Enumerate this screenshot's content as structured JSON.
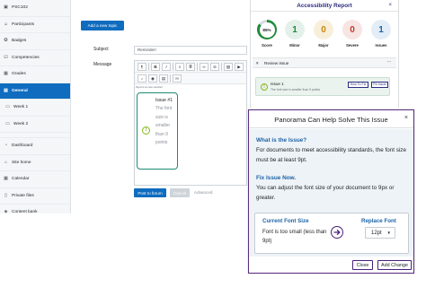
{
  "sidebar": {
    "items": [
      {
        "label": "PSC102",
        "icon": "graduation-cap-icon",
        "glyph": "▣"
      },
      {
        "label": "Participants",
        "icon": "users-icon",
        "glyph": "☺"
      },
      {
        "label": "Badges",
        "icon": "badge-icon",
        "glyph": "✪"
      },
      {
        "label": "Competencies",
        "icon": "checklist-icon",
        "glyph": "☑"
      },
      {
        "label": "Grades",
        "icon": "table-icon",
        "glyph": "▦"
      },
      {
        "label": "General",
        "icon": "folder-icon",
        "glyph": "▤",
        "active": true
      },
      {
        "label": "Week 1",
        "icon": "folder-icon",
        "glyph": "▭"
      },
      {
        "label": "Week 2",
        "icon": "folder-icon",
        "glyph": "▭"
      },
      {
        "label": "Dashboard",
        "icon": "dashboard-icon",
        "glyph": "◔"
      },
      {
        "label": "Site home",
        "icon": "home-icon",
        "glyph": "⌂"
      },
      {
        "label": "Calendar",
        "icon": "calendar-icon",
        "glyph": "▦"
      },
      {
        "label": "Private files",
        "icon": "file-icon",
        "glyph": "▯"
      },
      {
        "label": "Content bank",
        "icon": "cube-icon",
        "glyph": "◈"
      },
      {
        "label": "My courses",
        "icon": "graduation-cap-icon",
        "glyph": "▣"
      },
      {
        "label": "WCAG courses",
        "icon": "graduation-cap-icon",
        "glyph": "▣"
      }
    ]
  },
  "course": {
    "add_topic_label": "Add a new topic",
    "subject_label": "Subject",
    "subject_value": "Reminder!",
    "message_label": "Message",
    "reports_text": "Reports are also standard",
    "post_label": "Post to forum",
    "cancel_label": "Cancel",
    "advanced_label": "Advanced",
    "card": {
      "title": "Issue #1",
      "text": "The font size is smaller than 9 points"
    }
  },
  "report": {
    "title": "Accessibility Report",
    "close": "×",
    "score": {
      "value": "85%",
      "percent": 85,
      "label": "Score"
    },
    "metrics": [
      {
        "value": "1",
        "label": "Minor",
        "color": "#1f8a3a",
        "bg": "#e4f1ea"
      },
      {
        "value": "0",
        "label": "Major",
        "color": "#c8860a",
        "bg": "#f8efdb"
      },
      {
        "value": "0",
        "label": "Severe",
        "color": "#c0392b",
        "bg": "#f7e5e3"
      },
      {
        "value": "1",
        "label": "Issues",
        "color": "#1e63a6",
        "bg": "#e3edf7"
      }
    ],
    "review_label": "Review Issue",
    "more": "···",
    "issue": {
      "title": "Issue 1",
      "desc": "The font size is smaller than 9 points",
      "how_to_fix": "How To Fix",
      "fix_issue": "Fix Issue"
    }
  },
  "modal": {
    "title": "Panorama Can Help Solve This Issue",
    "close": "×",
    "what_heading": "What is the Issue?",
    "what_text": "For documents to meet accessibility standards, the font size must be at least 9pt.",
    "fix_heading": "Fix Issue Now.",
    "fix_text": "You can adjust the font size of your document to 9px or greater.",
    "current_heading": "Current Font Size",
    "current_text": "Font is too small (less than 9pt)",
    "replace_heading": "Replace Font",
    "replace_value": "12pt",
    "close_label": "Close",
    "add_change_label": "Add Change"
  }
}
